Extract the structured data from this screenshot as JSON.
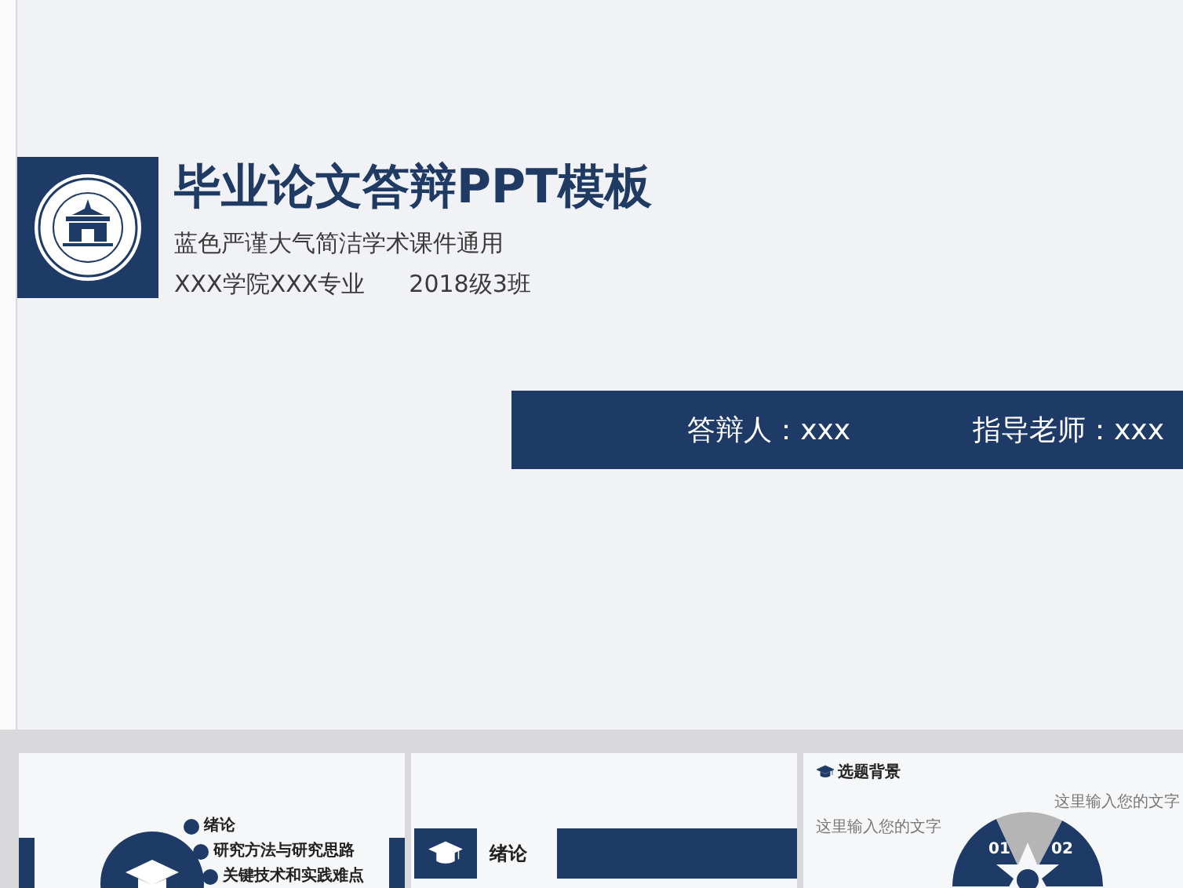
{
  "title": "毕业论文答辩PPT模板",
  "subtitle": "蓝色严谨大气简洁学术课件通用",
  "class_line": [
    "XXX学院XXX专业",
    "2018级3班"
  ],
  "presenter_bar": [
    "答辩人：xxx",
    "指导老师：xxx"
  ],
  "thumbnails": [
    {
      "kind": "contents",
      "items": [
        "绪论",
        "研究方法与研究思路",
        "关键技术和实践难点"
      ]
    },
    {
      "kind": "section",
      "heading": "绪论"
    },
    {
      "kind": "diagram",
      "heading": "选题背景",
      "labels": [
        "这里输入您的文字",
        "这里输入您的文字"
      ],
      "numbers": [
        "01",
        "02"
      ]
    }
  ]
}
